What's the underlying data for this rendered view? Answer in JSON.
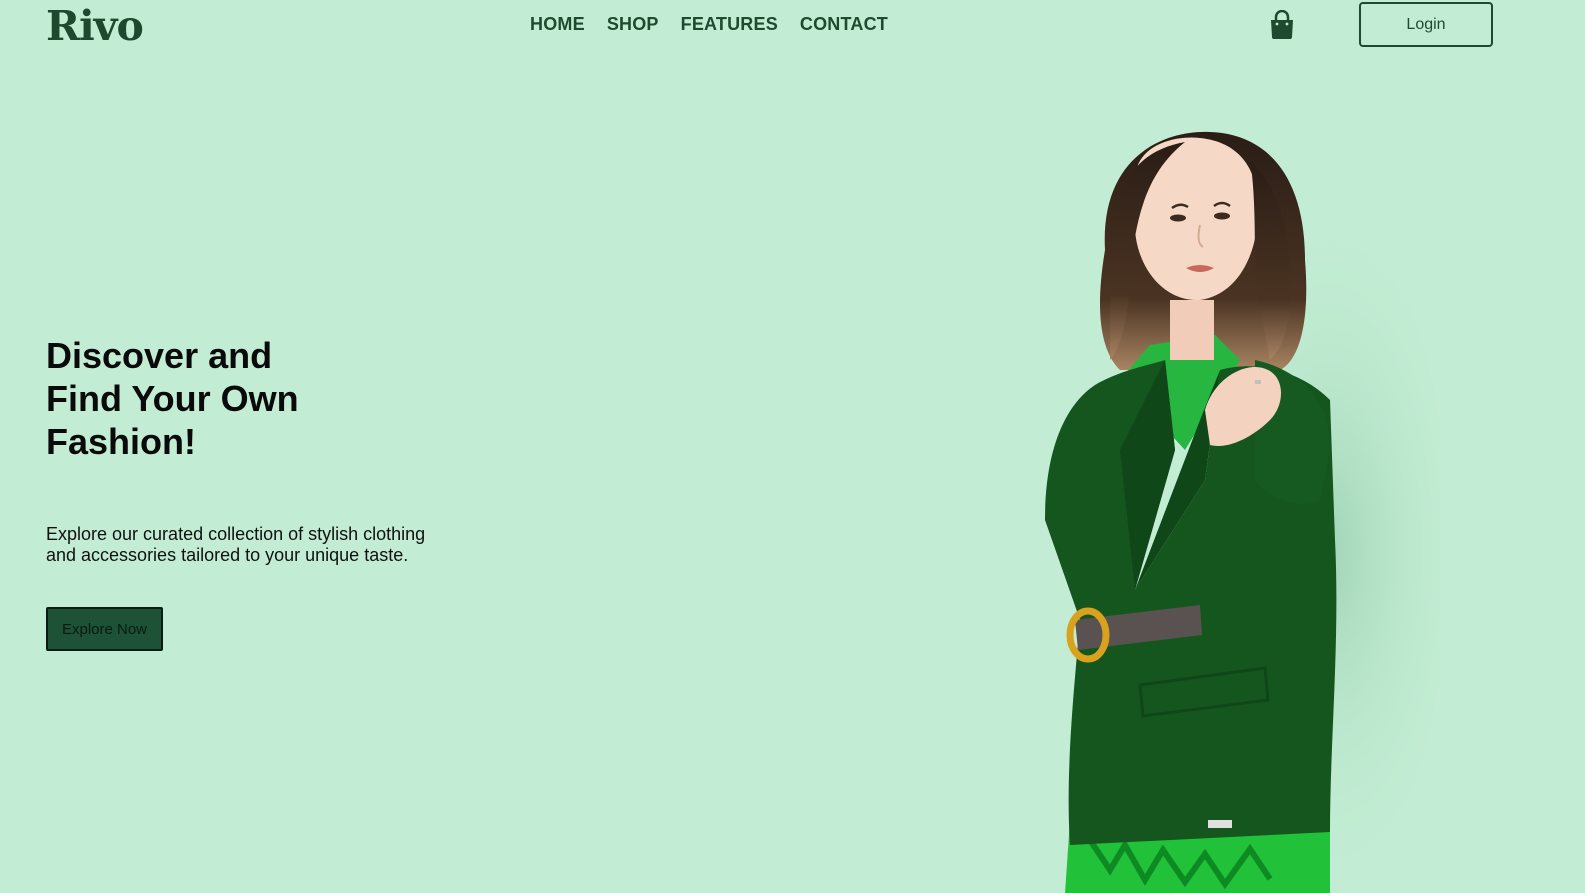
{
  "header": {
    "logo": "Rivo",
    "nav": [
      {
        "label": "HOME"
      },
      {
        "label": "SHOP"
      },
      {
        "label": "FEATURES"
      },
      {
        "label": "CONTACT"
      }
    ],
    "cart_icon": "shopping-bag-icon",
    "login_label": "Login"
  },
  "hero": {
    "title_lines": [
      "Discover and",
      "Find Your Own",
      "Fashion!"
    ],
    "description": "Explore our curated collection of stylish clothing and accessories tailored to your unique taste.",
    "cta_label": "Explore Now",
    "image": "woman-in-green-blazer"
  },
  "colors": {
    "background": "#c2edd4",
    "brand_dark_green": "#1e4a30",
    "cta_fill": "#1d5236"
  }
}
